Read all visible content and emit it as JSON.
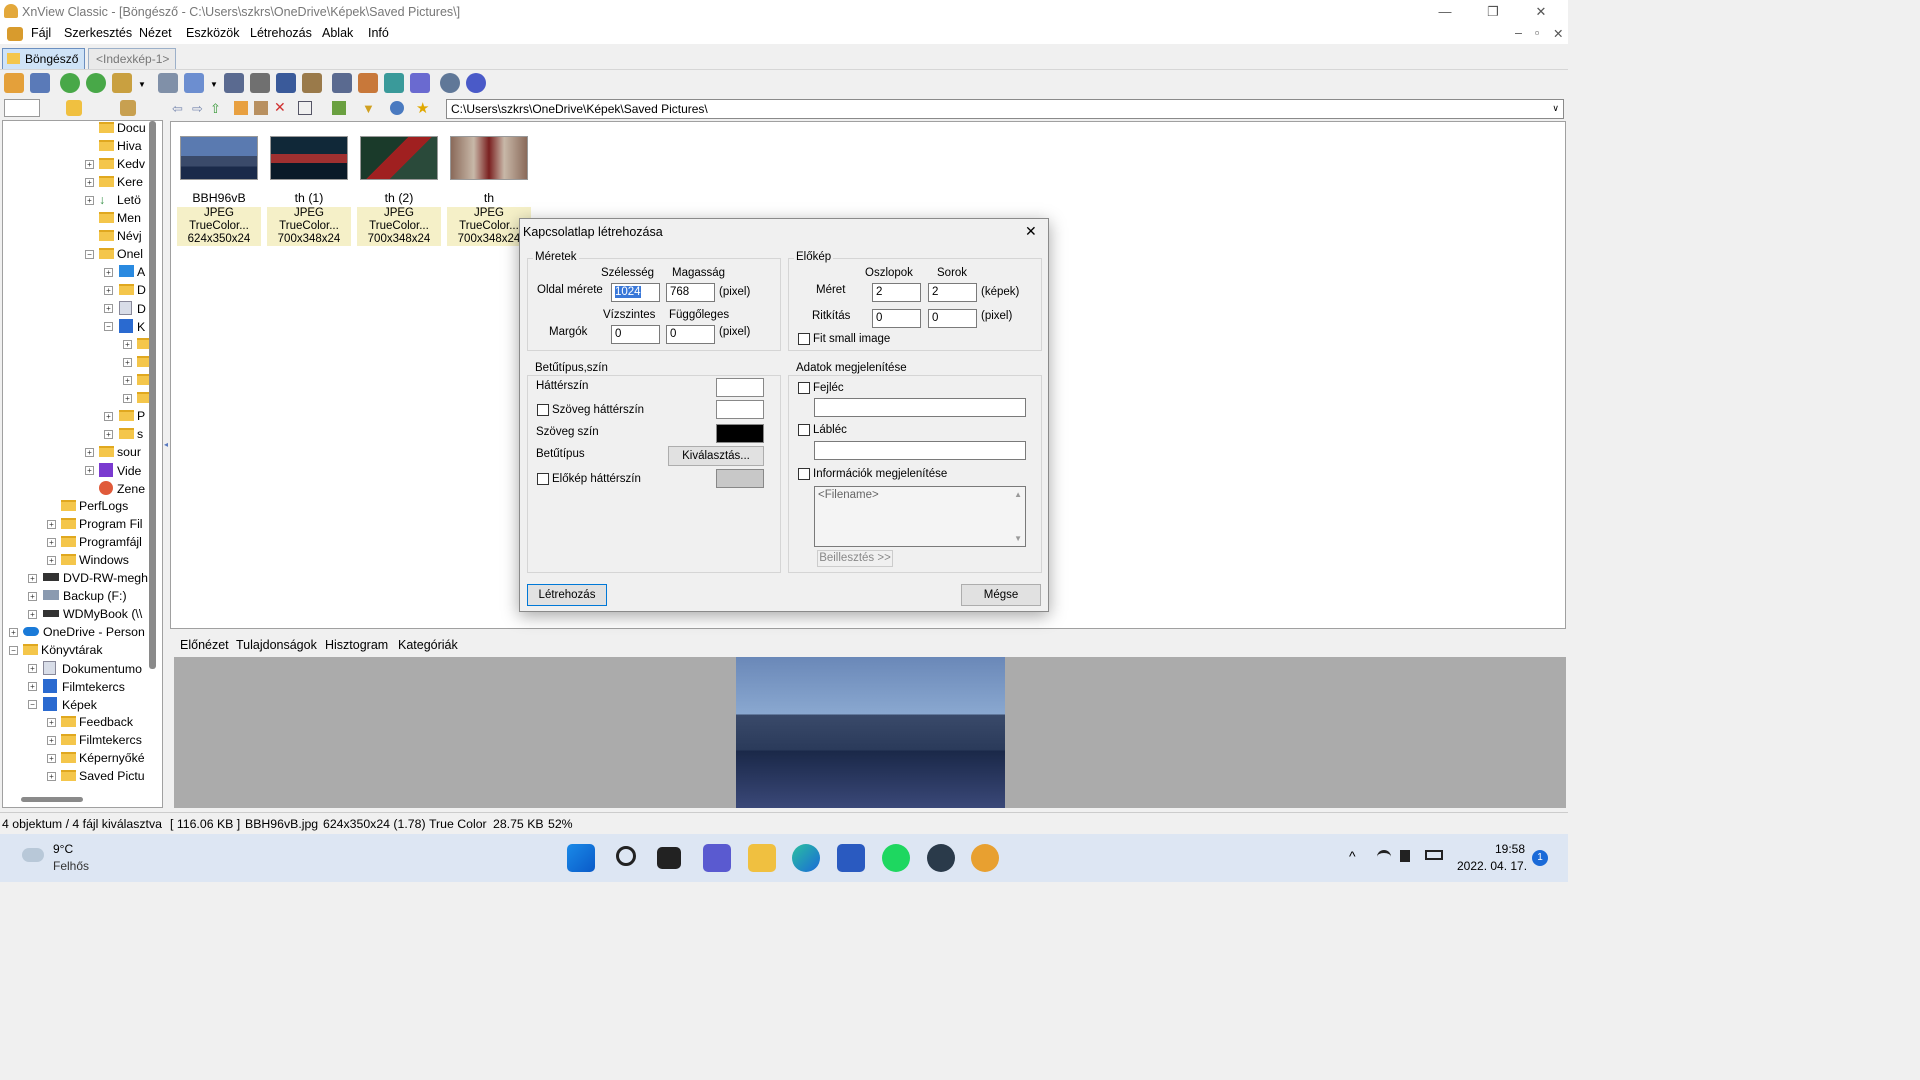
{
  "window": {
    "title": "XnView Classic - [Böngésző - C:\\Users\\szkrs\\OneDrive\\Képek\\Saved Pictures\\]",
    "minimize": "—",
    "restore": "❐",
    "close": "✕"
  },
  "menu": [
    "Fájl",
    "Szerkesztés",
    "Nézet",
    "Eszközök",
    "Létrehozás",
    "Ablak",
    "Infó"
  ],
  "mdi_controls": [
    "–",
    "▫",
    "✕"
  ],
  "tabs": [
    {
      "label": "Böngésző",
      "active": true
    },
    {
      "label": "<Indexkép-1>",
      "active": false
    }
  ],
  "address": "C:\\Users\\szkrs\\OneDrive\\Képek\\Saved Pictures\\",
  "tree": [
    "Docu",
    "Hiva",
    "Kedv",
    "Kere",
    "Letö",
    "Men",
    "Névj",
    "Onel",
    "A",
    "D",
    "D",
    "K",
    "",
    "",
    "",
    "",
    "P",
    "s",
    "sour",
    "Vide",
    "Zene",
    "PerfLogs",
    "Program Fil",
    "Programfájl",
    "Windows",
    "DVD-RW-megh",
    "Backup (F:)",
    "WDMyBook (\\\\",
    "OneDrive - Person",
    "Könyvtárak",
    "Dokumentumo",
    "Filmtekercs",
    "Képek",
    "Feedback",
    "Filmtekercs",
    "Képernyőké",
    "Saved Pictu"
  ],
  "thumbnails": [
    {
      "name": "BBH96vB",
      "type": "JPEG TrueColor...",
      "dims": "624x350x24"
    },
    {
      "name": "th (1)",
      "type": "JPEG TrueColor...",
      "dims": "700x348x24"
    },
    {
      "name": "th (2)",
      "type": "JPEG TrueColor...",
      "dims": "700x348x24"
    },
    {
      "name": "th",
      "type": "JPEG TrueColor...",
      "dims": "700x348x24"
    }
  ],
  "dialog": {
    "title": "Kapcsolatlap létrehozása",
    "close": "✕",
    "sizes": {
      "group": "Méretek",
      "width_label": "Szélesség",
      "height_label": "Magasság",
      "page_size_label": "Oldal mérete",
      "width": "1024",
      "height": "768",
      "unit": "(pixel)",
      "horiz_label": "Vízszintes",
      "vert_label": "Függőleges",
      "margins_label": "Margók",
      "margin_h": "0",
      "margin_v": "0",
      "unit2": "(pixel)"
    },
    "preview": {
      "group": "Előkép",
      "cols_label": "Oszlopok",
      "rows_label": "Sorok",
      "size_label": "Méret",
      "cols": "2",
      "rows": "2",
      "unit": "(képek)",
      "spacing_label": "Ritkítás",
      "space_h": "0",
      "space_v": "0",
      "unit2": "(pixel)",
      "fit_small": "Fit small image"
    },
    "font": {
      "group": "Betűtípus,szín",
      "bg_label": "Háttérszín",
      "text_bg_label": "Szöveg háttérszín",
      "text_color_label": "Szöveg szín",
      "font_label": "Betűtípus",
      "choose_button": "Kiválasztás...",
      "thumb_bg_label": "Előkép háttérszín",
      "bg_color": "#ffffff",
      "text_bg_color": "#ffffff",
      "text_color": "#000000",
      "thumb_bg_color": "#c8c8c8"
    },
    "data": {
      "group": "Adatok megjelenítése",
      "header_label": "Fejléc",
      "footer_label": "Lábléc",
      "info_label": "Információk megjelenítése",
      "info_value": "<Filename>",
      "insert_button": "Beillesztés >>"
    },
    "create_button": "Létrehozás",
    "cancel_button": "Mégse"
  },
  "preview_tabs": [
    "Előnézet",
    "Tulajdonságok",
    "Hisztogram",
    "Kategóriák"
  ],
  "status": [
    "4 objektum / 4 fájl kiválasztva",
    "[ 116.06 KB ]",
    "BBH96vB.jpg",
    "624x350x24 (1.78)",
    "True Color",
    "28.75 KB",
    "52%"
  ],
  "taskbar": {
    "weather_temp": "9°C",
    "weather_desc": "Felhős",
    "time": "19:58",
    "date": "2022. 04. 17.",
    "notifications": "1",
    "tray_icons": [
      "^",
      "wifi-icon",
      "speaker-icon",
      "battery-icon"
    ]
  }
}
